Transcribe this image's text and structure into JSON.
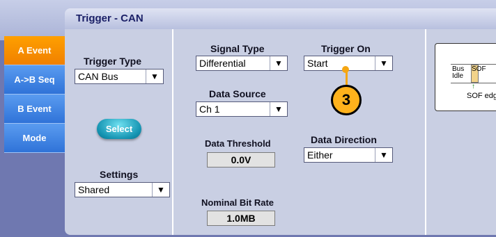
{
  "window": {
    "title": "Trigger - CAN"
  },
  "tabs": [
    {
      "label": "A Event",
      "active": true
    },
    {
      "label": "A->B Seq",
      "active": false
    },
    {
      "label": "B Event",
      "active": false
    },
    {
      "label": "Mode",
      "active": false
    }
  ],
  "trigger_type": {
    "label": "Trigger Type",
    "value": "CAN Bus"
  },
  "select_button": {
    "label": "Select"
  },
  "settings": {
    "label": "Settings",
    "value": "Shared"
  },
  "signal_type": {
    "label": "Signal Type",
    "value": "Differential"
  },
  "data_source": {
    "label": "Data Source",
    "value": "Ch 1"
  },
  "data_threshold": {
    "label": "Data Threshold",
    "value": "0.0V"
  },
  "nominal_bit_rate": {
    "label": "Nominal Bit Rate",
    "value": "1.0MB"
  },
  "trigger_on": {
    "label": "Trigger On",
    "value": "Start"
  },
  "data_direction": {
    "label": "Data Direction",
    "value": "Either"
  },
  "callout": {
    "number": "3"
  },
  "diagram": {
    "bus_idle": "Bus Idle",
    "sof": "SOF",
    "sof_edge": "SOF edge"
  },
  "icons": {
    "dropdown_arrow": "▼"
  },
  "colors": {
    "active_tab": "#f08000",
    "tab": "#2f73d8",
    "select_button": "#1594b2",
    "callout": "#ffb21c"
  }
}
